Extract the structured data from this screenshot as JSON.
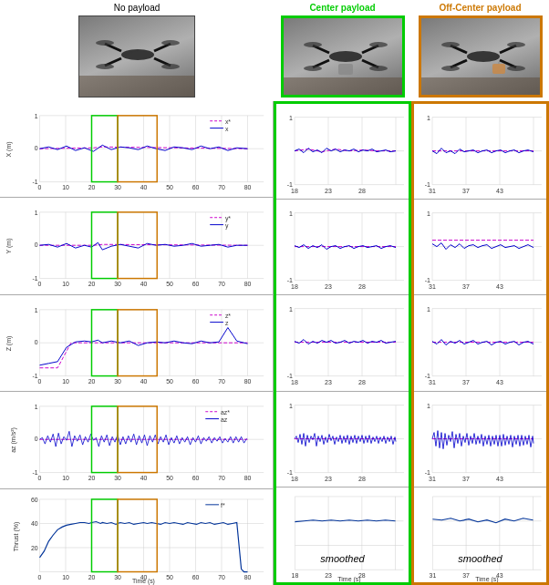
{
  "header": {
    "no_payload_label": "No payload",
    "center_payload_label": "Center payload",
    "off_center_label": "Off-Center payload"
  },
  "plots": {
    "left": {
      "rows": [
        {
          "ylabel": "X (m)",
          "yrange": "1 to -1",
          "xrange": "0 to 80",
          "legend_ref": "x*",
          "legend_actual": "x"
        },
        {
          "ylabel": "Y (m)",
          "yrange": "1 to -1",
          "xrange": "0 to 80",
          "legend_ref": "y*",
          "legend_actual": "y"
        },
        {
          "ylabel": "Z (m)",
          "yrange": "1 to -1",
          "xrange": "0 to 80",
          "legend_ref": "z*",
          "legend_actual": "z"
        },
        {
          "ylabel": "az (m/s²)",
          "yrange": "1 to -1",
          "xrange": "0 to 80",
          "legend_ref": "az*",
          "legend_actual": "az"
        },
        {
          "ylabel": "Thrust (%)",
          "yrange": "",
          "xrange": "0 to 80",
          "legend_ref": "f*",
          "legend_actual": ""
        }
      ],
      "xlabel": "Time (s)"
    },
    "center": {
      "rows": [
        {
          "xrange": "18 to 28",
          "smoothed": false
        },
        {
          "xrange": "18 to 28",
          "smoothed": false
        },
        {
          "xrange": "18 to 28",
          "smoothed": false
        },
        {
          "xrange": "18 to 28",
          "smoothed": false
        },
        {
          "xrange": "18 to 28",
          "smoothed": true
        }
      ],
      "xlabel": "Time (s)",
      "smoothed_text": "smoothed"
    },
    "offcenter": {
      "rows": [
        {
          "xrange": "31 to 43",
          "smoothed": false
        },
        {
          "xrange": "31 to 43",
          "smoothed": false
        },
        {
          "xrange": "31 to 43",
          "smoothed": false
        },
        {
          "xrange": "31 to 43",
          "smoothed": false
        },
        {
          "xrange": "31 to 43",
          "smoothed": true
        }
      ],
      "xlabel": "Time (s)",
      "smoothed_text": "smoothed"
    }
  },
  "colors": {
    "green_border": "#00cc00",
    "orange_border": "#cc7700",
    "reference_line": "#cc00cc",
    "actual_line": "#0000cc",
    "thrust_line": "#003399",
    "grid": "#cccccc"
  }
}
